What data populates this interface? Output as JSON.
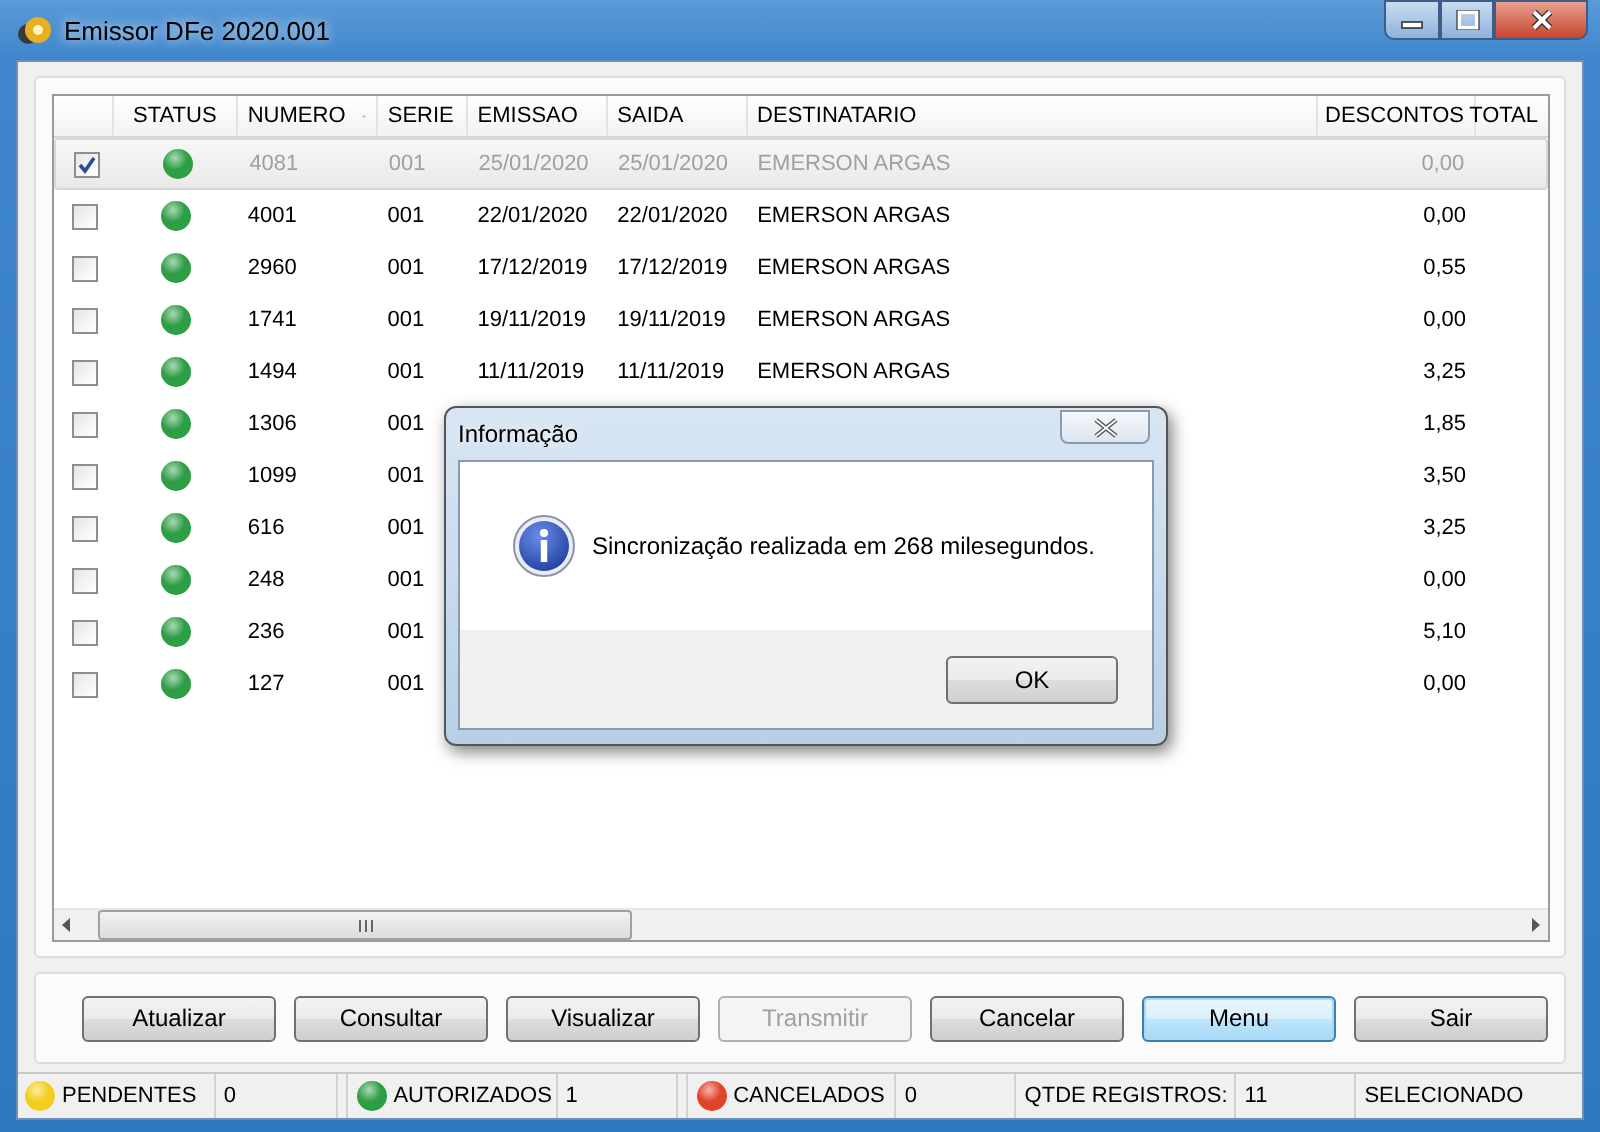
{
  "window": {
    "title": "Emissor DFe 2020.001"
  },
  "table": {
    "columns": [
      {
        "label": "STATUS",
        "sorted": false
      },
      {
        "label": "NUMERO",
        "sorted": true
      },
      {
        "label": "SERIE",
        "sorted": false
      },
      {
        "label": "EMISSAO",
        "sorted": false
      },
      {
        "label": "SAIDA",
        "sorted": false
      },
      {
        "label": "DESTINATARIO",
        "sorted": false
      },
      {
        "label": "DESCONTOS",
        "sorted": false
      },
      {
        "label": "TOTAL",
        "sorted": false
      }
    ],
    "rows": [
      {
        "checked": true,
        "selected": true,
        "color": "#2e9e45",
        "cells": [
          "",
          "4081",
          "001",
          "25/01/2020",
          "25/01/2020",
          "EMERSON ARGAS",
          "0,00"
        ]
      },
      {
        "checked": false,
        "selected": false,
        "color": "#2e9e45",
        "cells": [
          "",
          "4001",
          "001",
          "22/01/2020",
          "22/01/2020",
          "EMERSON ARGAS",
          "0,00"
        ]
      },
      {
        "checked": false,
        "selected": false,
        "color": "#2e9e45",
        "cells": [
          "",
          "2960",
          "001",
          "17/12/2019",
          "17/12/2019",
          "EMERSON ARGAS",
          "0,55"
        ]
      },
      {
        "checked": false,
        "selected": false,
        "color": "#2e9e45",
        "cells": [
          "",
          "1741",
          "001",
          "19/11/2019",
          "19/11/2019",
          "EMERSON ARGAS",
          "0,00"
        ]
      },
      {
        "checked": false,
        "selected": false,
        "color": "#2e9e45",
        "cells": [
          "",
          "1494",
          "001",
          "11/11/2019",
          "11/11/2019",
          "EMERSON ARGAS",
          "3,25"
        ]
      },
      {
        "checked": false,
        "selected": false,
        "color": "#2e9e45",
        "cells": [
          "",
          "1306",
          "001",
          "",
          "",
          "",
          "1,85"
        ]
      },
      {
        "checked": false,
        "selected": false,
        "color": "#2e9e45",
        "cells": [
          "",
          "1099",
          "001",
          "",
          "",
          "",
          "3,50"
        ]
      },
      {
        "checked": false,
        "selected": false,
        "color": "#2e9e45",
        "cells": [
          "",
          "616",
          "001",
          "",
          "",
          "",
          "3,25"
        ]
      },
      {
        "checked": false,
        "selected": false,
        "color": "#2e9e45",
        "cells": [
          "",
          "248",
          "001",
          "",
          "",
          "",
          "0,00"
        ]
      },
      {
        "checked": false,
        "selected": false,
        "color": "#2e9e45",
        "cells": [
          "",
          "236",
          "001",
          "",
          "",
          "",
          "5,10"
        ]
      },
      {
        "checked": false,
        "selected": false,
        "color": "#2e9e45",
        "cells": [
          "",
          "127",
          "001",
          "",
          "",
          "",
          "0,00"
        ]
      }
    ]
  },
  "buttons": [
    {
      "label": "Atualizar",
      "disabled": false,
      "default": false
    },
    {
      "label": "Consultar",
      "disabled": false,
      "default": false
    },
    {
      "label": "Visualizar",
      "disabled": false,
      "default": false
    },
    {
      "label": "Transmitir",
      "disabled": true,
      "default": false
    },
    {
      "label": "Cancelar",
      "disabled": false,
      "default": false
    },
    {
      "label": "Menu",
      "disabled": false,
      "default": true
    },
    {
      "label": "Sair",
      "disabled": false,
      "default": false
    }
  ],
  "status_bar": [
    {
      "kind": "counter",
      "label": "PENDENTES",
      "color": "#f2cf1c",
      "value": "0"
    },
    {
      "kind": "counter",
      "label": "AUTORIZADOS",
      "color": "#2e9e45",
      "value": "1"
    },
    {
      "kind": "counter",
      "label": "CANCELADOS",
      "color": "#e0442a",
      "value": "0"
    },
    {
      "kind": "text",
      "label": "QTDE REGISTROS:",
      "value": "11"
    },
    {
      "kind": "text",
      "label": "SELECIONADO"
    }
  ],
  "dialog": {
    "title": "Informação",
    "message": "Sincronização realizada em 268 milesegundos.",
    "button": "OK"
  }
}
